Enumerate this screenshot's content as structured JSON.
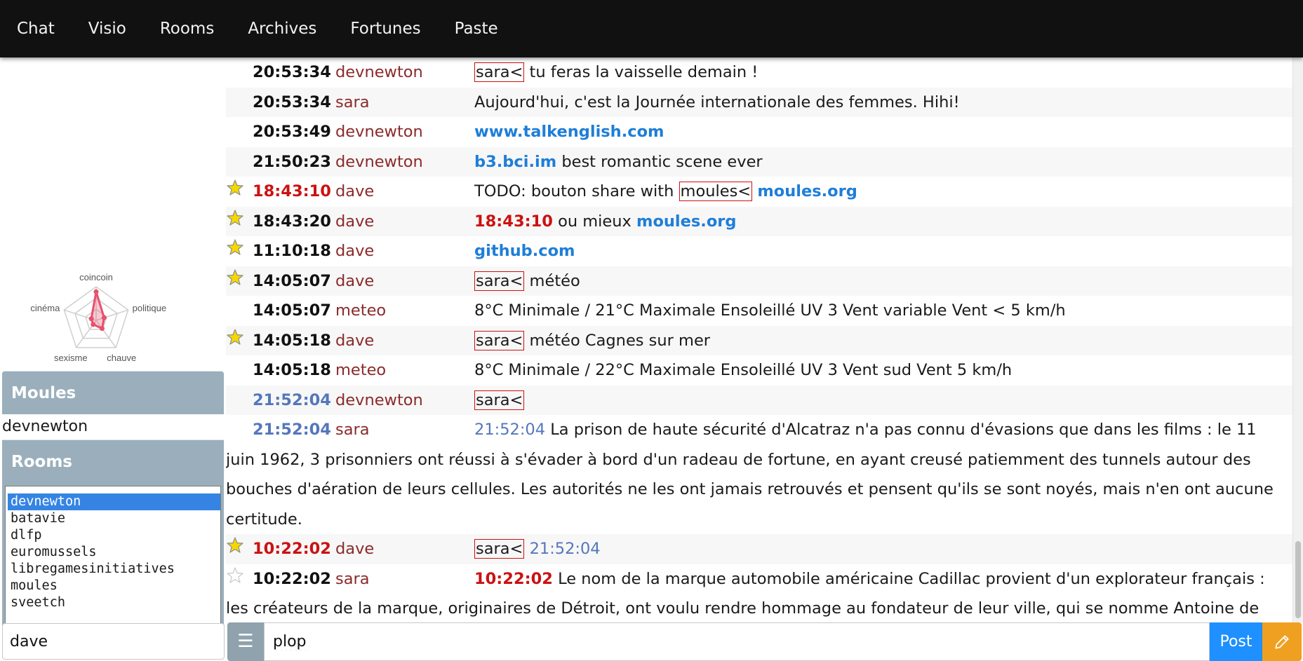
{
  "nav": {
    "items": [
      "Chat",
      "Visio",
      "Rooms",
      "Archives",
      "Fortunes",
      "Paste"
    ]
  },
  "radar": {
    "axes": [
      "coincoin",
      "politique",
      "chauve",
      "sexisme",
      "cinéma"
    ],
    "values": [
      0.85,
      0.25,
      0.3,
      0.15,
      0.15
    ],
    "color": "#e8506e"
  },
  "sidebar": {
    "moules_title": "Moules",
    "moules": [
      "devnewton"
    ],
    "rooms_title": "Rooms",
    "rooms": [
      "devnewton",
      "batavie",
      "dlfp",
      "euromussels",
      "libregamesinitiatives",
      "moules",
      "sveetch"
    ],
    "selected_room": "devnewton",
    "nick_value": "dave"
  },
  "messages": [
    {
      "star": "none",
      "time": "20:53:34",
      "time_style": "normal",
      "nick": "devnewton",
      "parts": [
        {
          "t": "bigorno",
          "v": "sara<"
        },
        {
          "t": "text",
          "v": " tu feras la vaisselle demain !"
        }
      ]
    },
    {
      "star": "none",
      "time": "20:53:34",
      "time_style": "normal",
      "nick": "sara",
      "parts": [
        {
          "t": "text",
          "v": "Aujourd'hui, c'est la Journée internationale des femmes. Hihi!"
        }
      ]
    },
    {
      "star": "none",
      "time": "20:53:49",
      "time_style": "normal",
      "nick": "devnewton",
      "parts": [
        {
          "t": "link",
          "v": "www.talkenglish.com"
        }
      ]
    },
    {
      "star": "none",
      "time": "21:50:23",
      "time_style": "normal",
      "nick": "devnewton",
      "parts": [
        {
          "t": "link",
          "v": "b3.bci.im"
        },
        {
          "t": "text",
          "v": " best romantic scene ever"
        }
      ]
    },
    {
      "star": "gold",
      "time": "18:43:10",
      "time_style": "red",
      "nick": "dave",
      "parts": [
        {
          "t": "text",
          "v": "TODO: bouton share with "
        },
        {
          "t": "bigorno",
          "v": "moules<"
        },
        {
          "t": "text",
          "v": " "
        },
        {
          "t": "link",
          "v": "moules.org"
        }
      ]
    },
    {
      "star": "gold",
      "time": "18:43:20",
      "time_style": "normal",
      "nick": "dave",
      "parts": [
        {
          "t": "refred",
          "v": "18:43:10"
        },
        {
          "t": "text",
          "v": " ou mieux "
        },
        {
          "t": "link",
          "v": "moules.org"
        }
      ]
    },
    {
      "star": "gold",
      "time": "11:10:18",
      "time_style": "normal",
      "nick": "dave",
      "parts": [
        {
          "t": "link",
          "v": "github.com"
        }
      ]
    },
    {
      "star": "gold",
      "time": "14:05:07",
      "time_style": "normal",
      "nick": "dave",
      "parts": [
        {
          "t": "bigorno",
          "v": "sara<"
        },
        {
          "t": "text",
          "v": " météo"
        }
      ]
    },
    {
      "star": "none",
      "time": "14:05:07",
      "time_style": "normal",
      "nick": "meteo",
      "parts": [
        {
          "t": "text",
          "v": "8°C Minimale / 21°C Maximale Ensoleillé UV 3 Vent variable Vent < 5 km/h"
        }
      ]
    },
    {
      "star": "gold",
      "time": "14:05:18",
      "time_style": "normal",
      "nick": "dave",
      "parts": [
        {
          "t": "bigorno",
          "v": "sara<"
        },
        {
          "t": "text",
          "v": " météo Cagnes sur mer"
        }
      ]
    },
    {
      "star": "none",
      "time": "14:05:18",
      "time_style": "normal",
      "nick": "meteo",
      "parts": [
        {
          "t": "text",
          "v": "8°C Minimale / 22°C Maximale Ensoleillé UV 3 Vent sud Vent 5 km/h"
        }
      ]
    },
    {
      "star": "none",
      "time": "21:52:04",
      "time_style": "blue",
      "nick": "devnewton",
      "parts": [
        {
          "t": "bigorno",
          "v": "sara<"
        }
      ]
    },
    {
      "star": "none",
      "time": "21:52:04",
      "time_style": "blue",
      "nick": "sara",
      "wrap": true,
      "parts": [
        {
          "t": "refblue",
          "v": "21:52:04"
        },
        {
          "t": "text",
          "v": " La prison de haute sécurité d'Alcatraz n'a pas connu d'évasions que dans les films : le 11 juin 1962, 3 prisonniers ont réussi à s'évader à bord d'un radeau de fortune, en ayant creusé patiemment des tunnels autour des bouches d'aération de leurs cellules. Les autorités ne les ont jamais retrouvés et pensent qu'ils se sont noyés, mais n'en ont aucune certitude."
        }
      ]
    },
    {
      "star": "gold",
      "time": "10:22:02",
      "time_style": "red",
      "nick": "dave",
      "parts": [
        {
          "t": "bigorno",
          "v": "sara<"
        },
        {
          "t": "text",
          "v": " "
        },
        {
          "t": "refblue",
          "v": "21:52:04"
        }
      ]
    },
    {
      "star": "empty",
      "time": "10:22:02",
      "time_style": "normal",
      "nick": "sara",
      "wrap": true,
      "parts": [
        {
          "t": "refred",
          "v": "10:22:02"
        },
        {
          "t": "text",
          "v": " Le nom de la marque automobile américaine Cadillac provient d'un explorateur français : les créateurs de la marque, originaires de Détroit, ont voulu rendre hommage au fondateur de leur ville, qui se nomme Antoine de Lamothe-Cadillac. Le logo de la marque est aussi largement inspiré du blason d'Antoine de Lamothe-Cadillac."
        }
      ]
    }
  ],
  "post": {
    "menu_icon": "hamburger-icon",
    "input_value": "plop",
    "post_label": "Post",
    "pen_icon": "pencil-icon"
  },
  "colors": {
    "nav_bg": "#111111",
    "panel_head": "#9aafbb",
    "nick": "#8b2a2a",
    "link": "#1e7ed8",
    "ref_red": "#cc1111",
    "ref_blue": "#5577bb",
    "post_btn": "#1e90ff",
    "pen_btn": "#f0a020"
  }
}
